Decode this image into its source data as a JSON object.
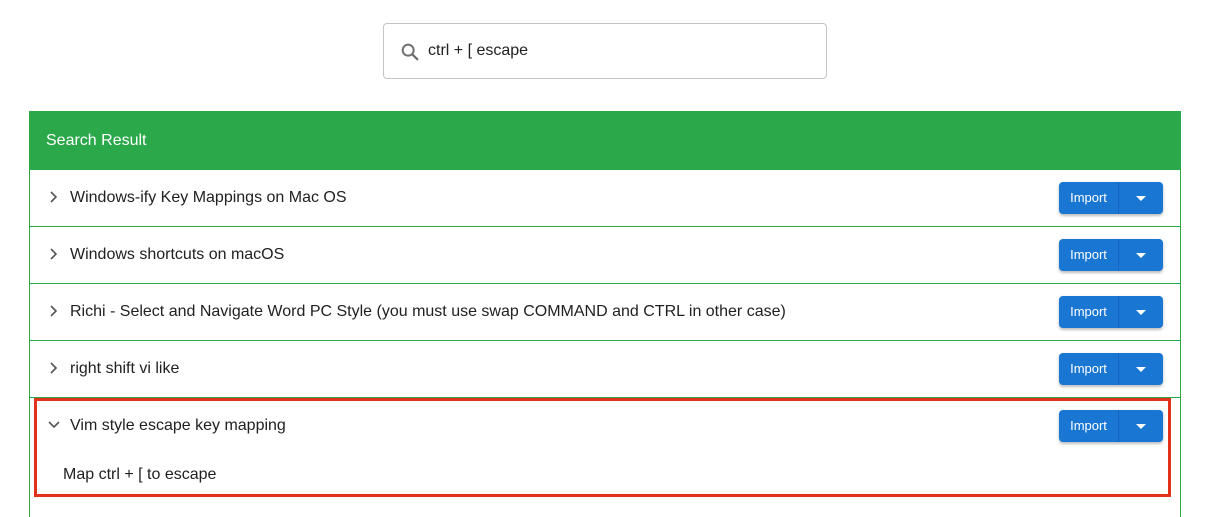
{
  "search": {
    "value": "ctrl + [ escape",
    "icon": "search-icon"
  },
  "results": {
    "header": "Search Result",
    "import_label": "Import",
    "items": [
      {
        "title": "Windows-ify Key Mappings on Mac OS",
        "expanded": false
      },
      {
        "title": "Windows shortcuts on macOS",
        "expanded": false
      },
      {
        "title": "Richi - Select and Navigate Word PC Style (you must use swap COMMAND and CTRL in other case)",
        "expanded": false
      },
      {
        "title": "right shift vi like",
        "expanded": false
      },
      {
        "title": "Vim style escape key mapping",
        "expanded": true,
        "description": "Map ctrl + [ to escape"
      }
    ]
  },
  "colors": {
    "header_green": "#2aa84a",
    "button_blue": "#1976d2",
    "highlight_red": "#e2331a"
  }
}
